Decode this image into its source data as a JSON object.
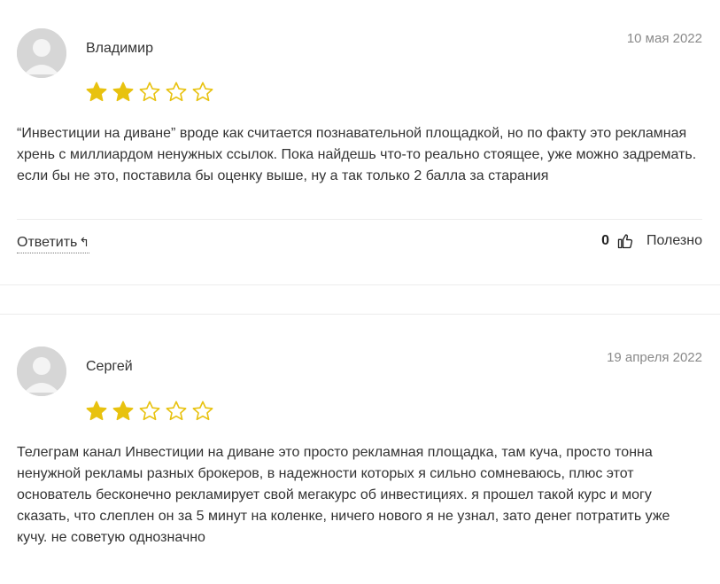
{
  "reviews": [
    {
      "author": "Владимир",
      "date": "10 мая 2022",
      "rating": 2,
      "max_rating": 5,
      "text": "“Инвестиции на диване” вроде как считается познавательной площадкой, но по факту это рекламная хрень с миллиардом ненужных ссылок. Пока найдешь что-то реально стоящее, уже можно задремать. если бы не это, поставила бы оценку выше, ну а так только 2 балла за старания",
      "reply_label": "Ответить",
      "reply_icon": "↰",
      "likes": "0",
      "useful_label": "Полезно"
    },
    {
      "author": "Сергей",
      "date": "19 апреля 2022",
      "rating": 2,
      "max_rating": 5,
      "text": "Телеграм канал Инвестиции на диване это просто рекламная площадка, там куча, просто тонна ненужной рекламы разных брокеров, в надежности которых я сильно сомневаюсь, плюс этот основатель бесконечно рекламирует свой мегакурс об инвестициях. я прошел такой курс и могу сказать, что слеплен он за 5 минут на коленке, ничего нового я не узнал, зато денег потратить уже кучу. не советую однозначно"
    }
  ],
  "colors": {
    "star": "#e8c20f",
    "avatar": "#d6d6d6",
    "divider": "#ececec"
  },
  "icons": {
    "avatar": "user-avatar-icon",
    "star": "star-icon",
    "reply": "reply-arrow-icon",
    "like": "thumbs-up-icon"
  }
}
